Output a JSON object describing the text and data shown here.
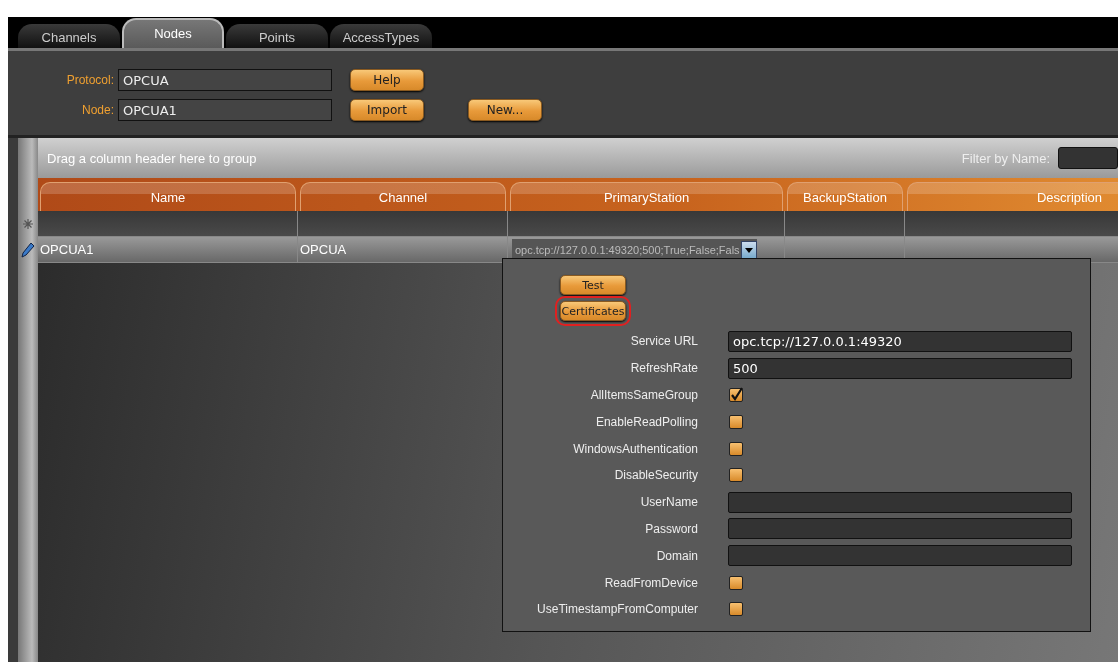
{
  "tabs": [
    {
      "label": "Channels",
      "selected": false
    },
    {
      "label": "Nodes",
      "selected": true
    },
    {
      "label": "Points",
      "selected": false
    },
    {
      "label": "AccessTypes",
      "selected": false
    }
  ],
  "toolbar": {
    "protocol": {
      "label": "Protocol:",
      "value": "OPCUA"
    },
    "node": {
      "label": "Node:",
      "value": "OPCUA1"
    },
    "buttons": [
      "Help",
      "Import",
      "New..."
    ]
  },
  "grid": {
    "group_hint": "Drag a column header here to group",
    "filter_label": "Filter by Name:",
    "columns": [
      "Name",
      "Channel",
      "PrimaryStation",
      "BackupStation",
      "Description"
    ],
    "rows": [
      {
        "name": "OPCUA1",
        "channel": "OPCUA",
        "primary_station": "opc.tcp://127.0.0.1:49320;500;True;False;Fals",
        "editing": true
      }
    ]
  },
  "dropdown": {
    "buttons": [
      {
        "label": "Test",
        "highlighted": false
      },
      {
        "label": "Certificates",
        "highlighted": true
      }
    ],
    "fields": [
      {
        "kind": "text",
        "label": "Service URL",
        "value": "opc.tcp://127.0.0.1:49320"
      },
      {
        "kind": "text",
        "label": "RefreshRate",
        "value": "500"
      },
      {
        "kind": "checkbox",
        "label": "AllItemsSameGroup",
        "checked": true
      },
      {
        "kind": "checkbox",
        "label": "EnableReadPolling",
        "checked": false
      },
      {
        "kind": "checkbox",
        "label": "WindowsAuthentication",
        "checked": false
      },
      {
        "kind": "checkbox",
        "label": "DisableSecurity",
        "checked": false
      },
      {
        "kind": "text",
        "label": "UserName"
      },
      {
        "kind": "text",
        "label": "Password"
      },
      {
        "kind": "text",
        "label": "Domain"
      },
      {
        "kind": "checkbox",
        "label": "ReadFromDevice",
        "checked": false
      },
      {
        "kind": "checkbox",
        "label": "UseTimestampFromComputer",
        "checked": false
      }
    ]
  }
}
